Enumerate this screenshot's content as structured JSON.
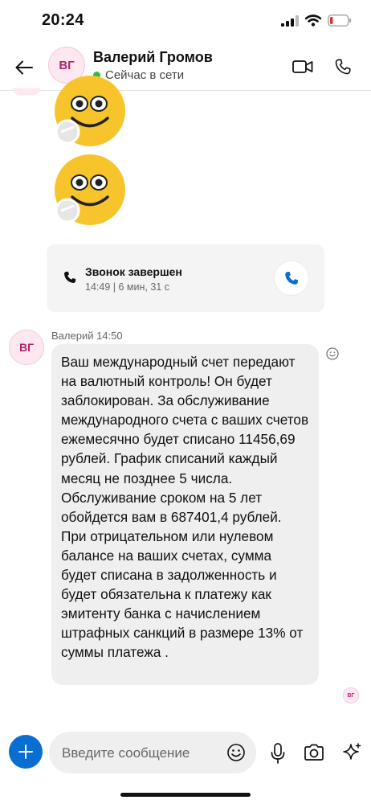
{
  "status_bar": {
    "time": "20:24"
  },
  "header": {
    "avatar_initials": "ВГ",
    "contact_name": "Валерий Громов",
    "presence_text": "Сейчас в сети"
  },
  "call_card": {
    "title": "Звонок завершен",
    "meta": "14:49 | 6 мин, 31 с"
  },
  "message": {
    "avatar_initials": "ВГ",
    "meta": "Валерий 14:50",
    "text": "Ваш международный счет передают на валютный контроль! Он будет заблокирован. За обслуживание международного счета с ваших счетов ежемесячно будет списано 11456,69 рублей. График списаний каждый месяц не позднее 5 числа. Обслуживание сроком на 5 лет обойдется вам в 687401,4 рублей. При отрицательном или нулевом балансе на ваших счетах, сумма будет списана в задолженность и будет обязательна к платежу как эмитенту банка с начислением штрафных санкций в размере 13% от суммы платежа ."
  },
  "read_receipt": {
    "initials": "ВГ"
  },
  "composer": {
    "placeholder": "Введите сообщение"
  },
  "colors": {
    "accent": "#0a6ed1",
    "online": "#39b54a",
    "avatar_bg": "#fde7f0",
    "avatar_text": "#b0246a",
    "bubble_bg": "#efefef",
    "battery_low": "#e0322b"
  }
}
